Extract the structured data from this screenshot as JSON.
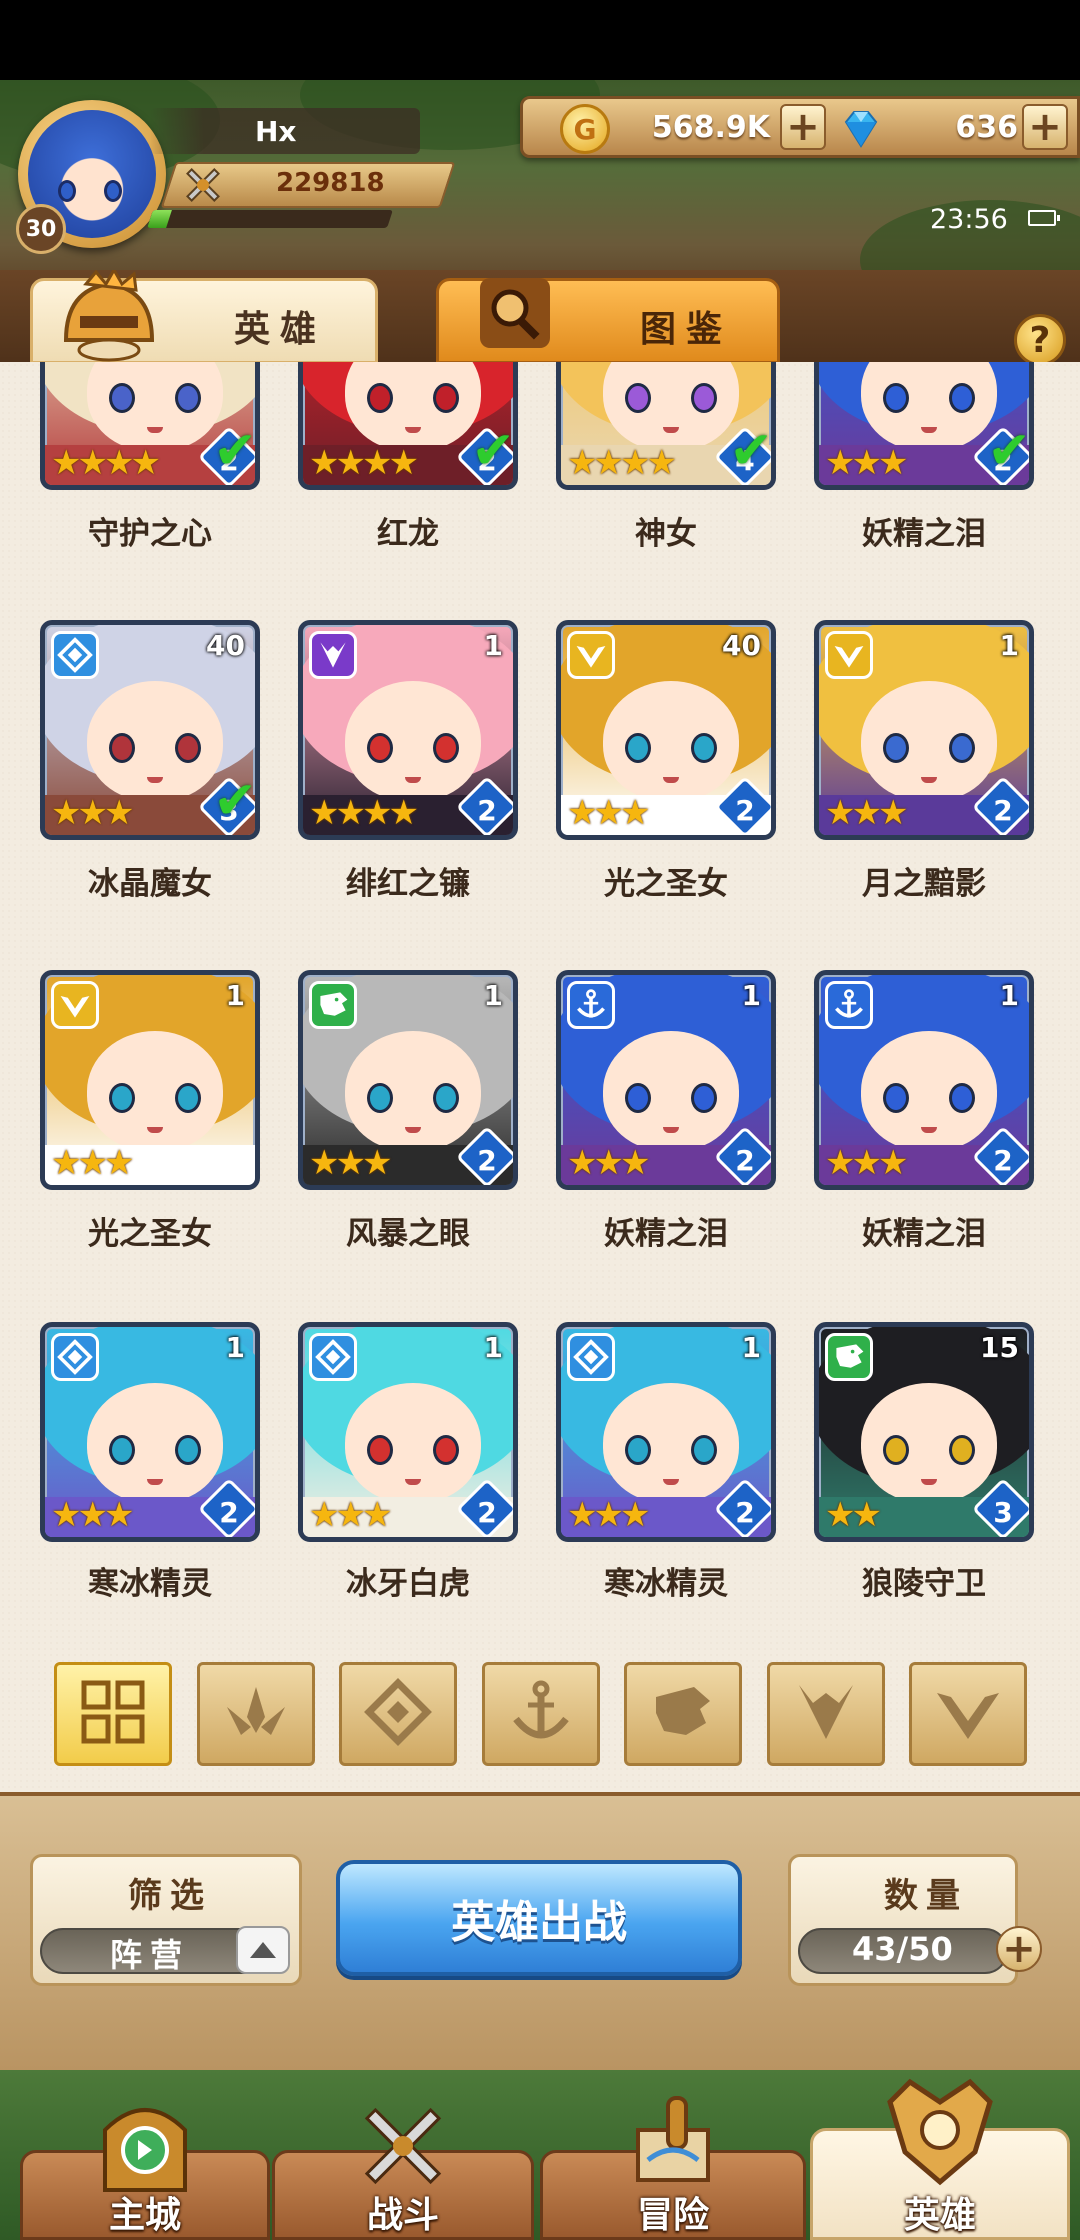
{
  "player": {
    "name": "Hx",
    "level": "30",
    "power": "229818",
    "xp_fraction": 0.08
  },
  "resources": {
    "gold": "568.9K",
    "gold_glyph": "G",
    "gems": "636"
  },
  "status": {
    "time": "23:56"
  },
  "tabs": [
    {
      "label": "英雄",
      "active": true,
      "icon": "helmet-icon"
    },
    {
      "label": "图鉴",
      "active": false,
      "icon": "magnifier-icon"
    }
  ],
  "help_glyph": "?",
  "heroes": [
    {
      "name": "守护之心",
      "stars": 4,
      "level": "",
      "rank": "2",
      "faction": "",
      "check": true,
      "hair": "#f1e3c4",
      "eye": "#4a63c9",
      "outfit": "#b54040"
    },
    {
      "name": "红龙",
      "stars": 4,
      "level": "",
      "rank": "2",
      "faction": "",
      "check": true,
      "hair": "#d8242c",
      "eye": "#c0202a",
      "outfit": "#6e1f28"
    },
    {
      "name": "神女",
      "stars": 4,
      "level": "",
      "rank": "4",
      "faction": "",
      "check": true,
      "hair": "#f3c35a",
      "eye": "#9b5ad8",
      "outfit": "#e9d6b0"
    },
    {
      "name": "妖精之泪",
      "stars": 3,
      "level": "",
      "rank": "2",
      "faction": "",
      "check": true,
      "hair": "#2e5fd6",
      "eye": "#2e5fd6",
      "outfit": "#6b3a9a"
    },
    {
      "name": "冰晶魔女",
      "stars": 3,
      "level": "40",
      "rank": "3",
      "faction": "ice",
      "check": true,
      "hair": "#cfd3e6",
      "eye": "#b0343b",
      "outfit": "#8a4a3a"
    },
    {
      "name": "绯红之镰",
      "stars": 4,
      "level": "1",
      "rank": "2",
      "faction": "demon",
      "check": false,
      "hair": "#f7a9bb",
      "eye": "#d3312f",
      "outfit": "#2a2030"
    },
    {
      "name": "光之圣女",
      "stars": 3,
      "level": "40",
      "rank": "2",
      "faction": "light",
      "check": false,
      "hair": "#e2a52a",
      "eye": "#2aa6c9",
      "outfit": "#ffffff"
    },
    {
      "name": "月之黯影",
      "stars": 3,
      "level": "1",
      "rank": "2",
      "faction": "light",
      "check": false,
      "hair": "#f0c040",
      "eye": "#3a6ad0",
      "outfit": "#5a3a9a"
    },
    {
      "name": "光之圣女",
      "stars": 3,
      "level": "1",
      "rank": "",
      "faction": "light",
      "check": false,
      "hair": "#e2a52a",
      "eye": "#2aa6c9",
      "outfit": "#ffffff"
    },
    {
      "name": "风暴之眼",
      "stars": 3,
      "level": "1",
      "rank": "2",
      "faction": "beast",
      "check": false,
      "hair": "#b8b8b8",
      "eye": "#2aa6c9",
      "outfit": "#2b2b2b"
    },
    {
      "name": "妖精之泪",
      "stars": 3,
      "level": "1",
      "rank": "2",
      "faction": "sea",
      "check": false,
      "hair": "#2e5fd6",
      "eye": "#2e5fd6",
      "outfit": "#6b3a9a"
    },
    {
      "name": "妖精之泪",
      "stars": 3,
      "level": "1",
      "rank": "2",
      "faction": "sea",
      "check": false,
      "hair": "#2e5fd6",
      "eye": "#2e5fd6",
      "outfit": "#6b3a9a"
    },
    {
      "name": "寒冰精灵",
      "stars": 3,
      "level": "1",
      "rank": "2",
      "faction": "ice",
      "check": false,
      "hair": "#38b9e2",
      "eye": "#2aa6c9",
      "outfit": "#6b58c9"
    },
    {
      "name": "冰牙白虎",
      "stars": 3,
      "level": "1",
      "rank": "2",
      "faction": "ice",
      "check": false,
      "hair": "#4fd9e2",
      "eye": "#d3312f",
      "outfit": "#f2eee2"
    },
    {
      "name": "寒冰精灵",
      "stars": 3,
      "level": "1",
      "rank": "2",
      "faction": "ice",
      "check": false,
      "hair": "#38b9e2",
      "eye": "#2aa6c9",
      "outfit": "#6b58c9"
    },
    {
      "name": "狼陵守卫",
      "stars": 2,
      "level": "15",
      "rank": "3",
      "faction": "beast",
      "check": false,
      "hair": "#1e1e22",
      "eye": "#e0b020",
      "outfit": "#2f7a6a"
    }
  ],
  "faction_colors": {
    "ice": "#2f8fe0",
    "demon": "#7a3ac9",
    "light": "#e8b520",
    "sea": "#2a6ad9",
    "beast": "#2fb04a"
  },
  "filter_tabs": [
    {
      "icon": "grid-icon",
      "active": true
    },
    {
      "icon": "sprout-icon",
      "active": false
    },
    {
      "icon": "diamond-icon",
      "active": false
    },
    {
      "icon": "anchor-icon",
      "active": false
    },
    {
      "icon": "beast-head-icon",
      "active": false
    },
    {
      "icon": "demon-horn-icon",
      "active": false
    },
    {
      "icon": "wing-v-icon",
      "active": false
    }
  ],
  "controls": {
    "filter_title": "筛选",
    "filter_value": "阵营",
    "deploy_label": "英雄出战",
    "count_title": "数量",
    "count_value": "43/50"
  },
  "nav": [
    {
      "label": "主城",
      "icon": "castle-icon",
      "active": false
    },
    {
      "label": "战斗",
      "icon": "crossed-swords-icon",
      "active": false
    },
    {
      "label": "冒险",
      "icon": "scroll-map-icon",
      "active": false
    },
    {
      "label": "英雄",
      "icon": "hero-crest-icon",
      "active": true
    }
  ]
}
